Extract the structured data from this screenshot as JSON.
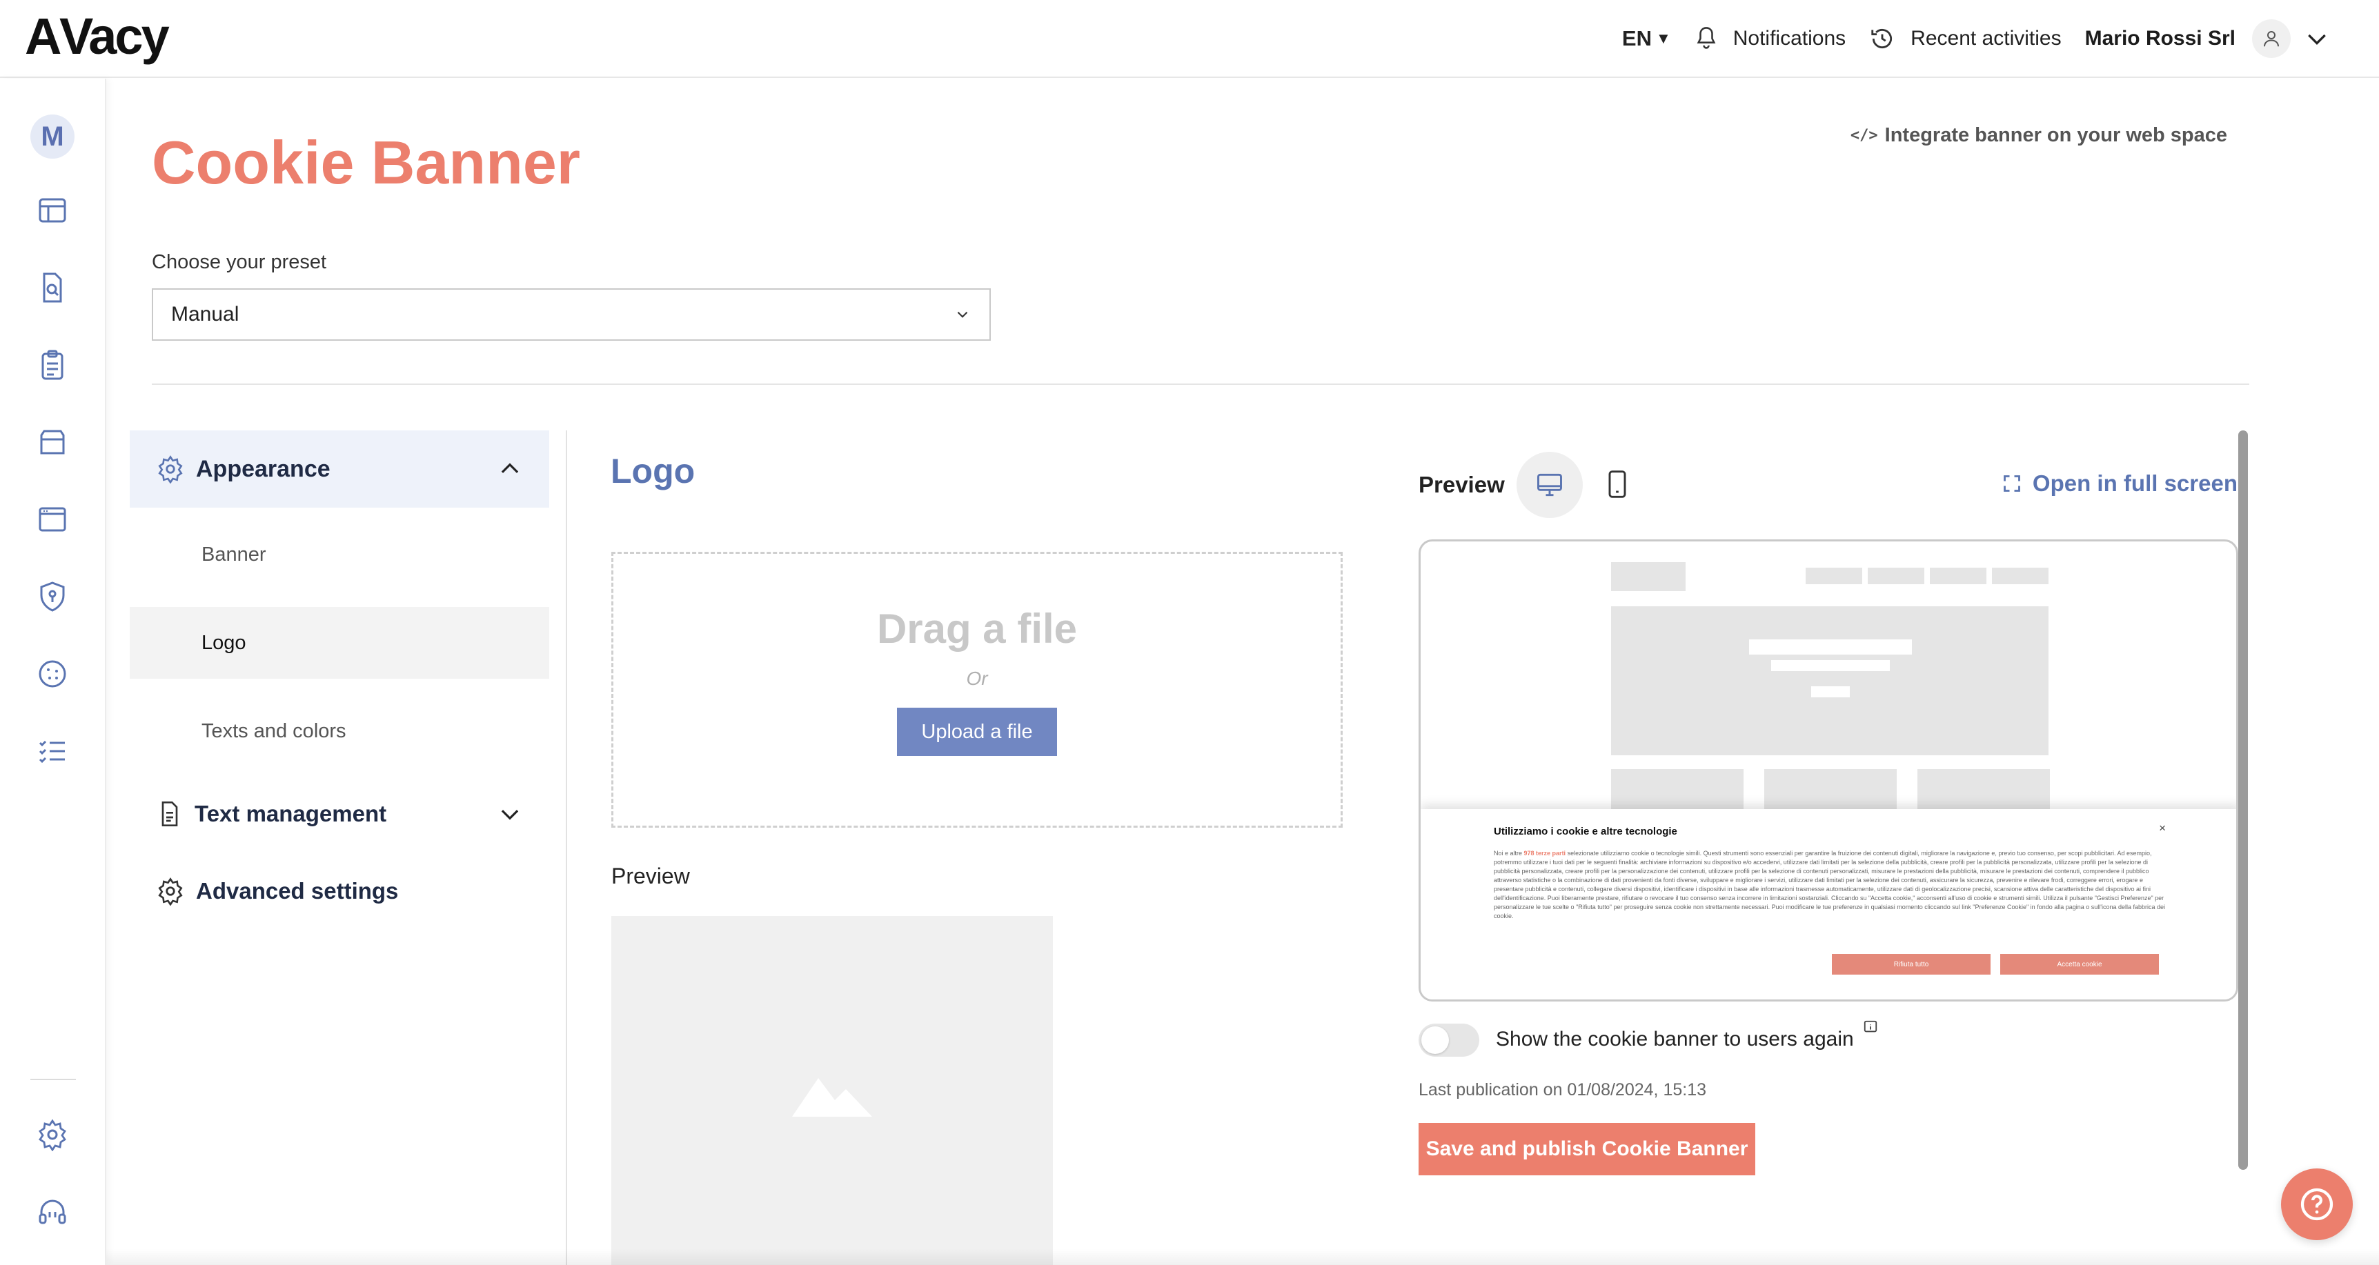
{
  "app": {
    "logo_text": "AVacy"
  },
  "topbar": {
    "language": "EN",
    "notifications_label": "Notifications",
    "recent_activities_label": "Recent activities",
    "company_name": "Mario Rossi Srl"
  },
  "rail": {
    "avatar_letter": "M",
    "icons": [
      "dashboard-icon",
      "document-search-icon",
      "clipboard-icon",
      "box-icon",
      "browser-window-icon",
      "shield-icon",
      "cookie-icon",
      "checklist-icon",
      "gear-icon",
      "headset-icon"
    ]
  },
  "page": {
    "title": "Cookie Banner",
    "integrate_link": "Integrate banner on your web space",
    "preset_label": "Choose your preset",
    "preset_value": "Manual"
  },
  "settings_nav": {
    "appearance": "Appearance",
    "sub_items": [
      "Banner",
      "Logo",
      "Texts and colors"
    ],
    "text_management": "Text management",
    "advanced_settings": "Advanced settings"
  },
  "logo_section": {
    "title": "Logo",
    "drag_text": "Drag a file",
    "or_text": "Or",
    "upload_button": "Upload a file",
    "preview_label": "Preview"
  },
  "preview_pane": {
    "label": "Preview",
    "open_full_screen": "Open in full screen",
    "banner_title": "Utilizziamo i cookie e altre tecnologie",
    "banner_close": "×",
    "banner_text_start": "Noi e altre ",
    "banner_text_highlight": "978 terze parti",
    "banner_text_rest": " selezionate utilizziamo cookie o tecnologie simili. Questi strumenti sono essenziali per garantire la fruizione dei contenuti digitali, migliorare la navigazione e, previo tuo consenso, per scopi pubblicitari. Ad esempio, potremmo utilizzare i tuoi dati per le seguenti finalità: archiviare informazioni su dispositivo e/o accedervi, utilizzare dati limitati per la selezione della pubblicità, creare profili per la pubblicità personalizzata, utilizzare profili per la selezione di pubblicità personalizzata, creare profili per la personalizzazione dei contenuti, utilizzare profili per la selezione di contenuti personalizzati, misurare le prestazioni della pubblicità, misurare le prestazioni dei contenuti, comprendere il pubblico attraverso statistiche o la combinazione di dati provenienti da fonti diverse, sviluppare e migliorare i servizi, utilizzare dati limitati per la selezione dei contenuti, assicurare la sicurezza, prevenire e rilevare frodi, correggere errori, erogare e presentare pubblicità e contenuti, collegare diversi dispositivi, identificare i dispositivi in base alle informazioni trasmesse automaticamente, utilizzare dati di geolocalizzazione precisi, scansione attiva delle caratteristiche del dispositivo ai fini dell'identificazione. Puoi liberamente prestare, rifiutare o revocare il tuo consenso senza incorrere in limitazioni sostanziali. Cliccando su \"Accetta cookie,\" acconsenti all'uso di cookie e strumenti simili. Utilizza il pulsante \"Gestisci Preferenze\" per personalizzare le tue scelte o \"Rifiuta tutto\" per proseguire senza cookie non strettamente necessari. Puoi modificare le tue preferenze in qualsiasi momento cliccando sul link \"Preferenze Cookie\" in fondo alla pagina o sull'icona della fabbrica dei cookie.",
    "reject_all": "Rifiuta tutto",
    "accept_cookies": "Accetta cookie",
    "toggle_label": "Show the cookie banner to users again",
    "toggle_on": false,
    "last_publication": "Last publication on 01/08/2024, 15:13",
    "publish_button": "Save and publish Cookie Banner"
  },
  "colors": {
    "brand_coral": "#ec7f6d",
    "brand_blue": "#5a74b1",
    "button_blue": "#7187c2"
  }
}
